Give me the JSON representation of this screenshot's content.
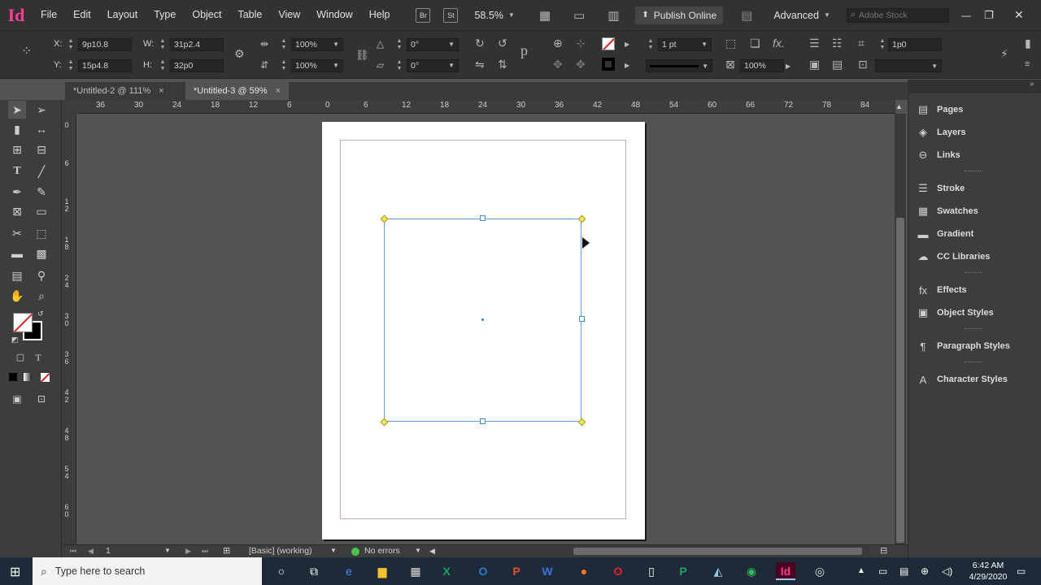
{
  "app": {
    "logo": "Id"
  },
  "menubar": {
    "items": [
      "File",
      "Edit",
      "Layout",
      "Type",
      "Object",
      "Table",
      "View",
      "Window",
      "Help"
    ],
    "bridge": "Br",
    "stock": "St",
    "zoom": "58.5%",
    "publish_label": "Publish Online",
    "workspace": "Advanced",
    "search_placeholder": "Adobe Stock"
  },
  "control": {
    "x_label": "X:",
    "x_value": "9p10.8",
    "y_label": "Y:",
    "y_value": "15p4.8",
    "w_label": "W:",
    "w_value": "31p2.4",
    "h_label": "H:",
    "h_value": "32p0",
    "scale_x": "100%",
    "scale_y": "100%",
    "rotate": "0°",
    "shear": "0°",
    "stroke_weight": "1 pt",
    "opacity": "100%",
    "offset": "1p0"
  },
  "tabs": [
    {
      "label": "*Untitled-2 @ 111%",
      "close": "×"
    },
    {
      "label": "*Untitled-3 @ 59%",
      "close": "×"
    }
  ],
  "ruler": {
    "h_labels": [
      "36",
      "30",
      "24",
      "18",
      "12",
      "6",
      "0",
      "6",
      "12",
      "18",
      "24",
      "30",
      "36",
      "42",
      "48",
      "54",
      "60",
      "66",
      "72",
      "78",
      "84"
    ],
    "v_labels": [
      "0",
      "6",
      "1\n2",
      "1\n8",
      "2\n4",
      "3\n0",
      "3\n6",
      "4\n2",
      "4\n8",
      "5\n4",
      "6\n0"
    ]
  },
  "status": {
    "page": "1",
    "style": "[Basic] (working)",
    "errors": "No errors"
  },
  "panels": [
    {
      "label": "Pages",
      "icon": "pages-icon"
    },
    {
      "label": "Layers",
      "icon": "layers-icon"
    },
    {
      "label": "Links",
      "icon": "links-icon"
    },
    {
      "label": "Stroke",
      "icon": "stroke-icon"
    },
    {
      "label": "Swatches",
      "icon": "swatches-icon"
    },
    {
      "label": "Gradient",
      "icon": "gradient-icon"
    },
    {
      "label": "CC Libraries",
      "icon": "cc-libraries-icon"
    },
    {
      "label": "Effects",
      "icon": "effects-icon"
    },
    {
      "label": "Object Styles",
      "icon": "object-styles-icon"
    },
    {
      "label": "Paragraph Styles",
      "icon": "paragraph-styles-icon"
    },
    {
      "label": "Character Styles",
      "icon": "character-styles-icon"
    }
  ],
  "taskbar": {
    "search_placeholder": "Type here to search",
    "time": "6:42 AM",
    "date": "4/29/2020"
  },
  "colors": {
    "accent": "#ff3f94",
    "selection": "#5aa2e0",
    "margin": "#d9a4c0"
  }
}
